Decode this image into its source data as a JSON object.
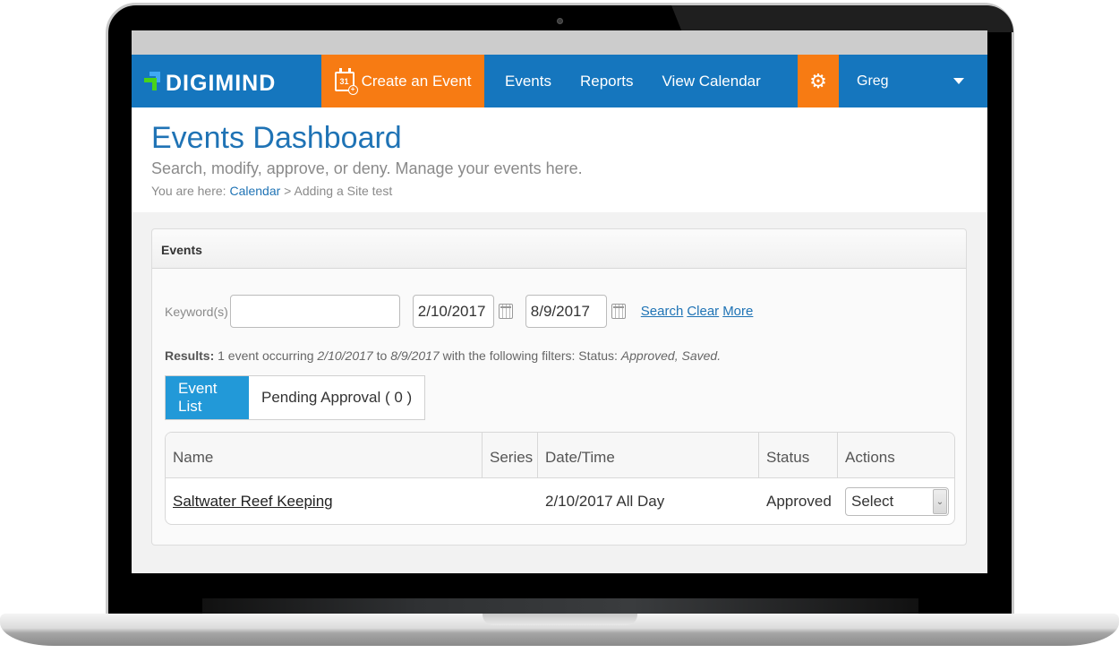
{
  "app": {
    "logo_text": "DIGIMIND"
  },
  "nav": {
    "create_label": "Create an Event",
    "create_icon_day": "31",
    "links": [
      "Events",
      "Reports",
      "View Calendar"
    ],
    "user_name": "Greg"
  },
  "header": {
    "title": "Events Dashboard",
    "subtitle": "Search, modify, approve, or deny. Manage your events here.",
    "breadcrumb_prefix": "You are here:",
    "breadcrumb_link": "Calendar",
    "breadcrumb_separator": ">",
    "breadcrumb_current": "Adding a Site test"
  },
  "panel": {
    "title": "Events",
    "keyword_label": "Keyword(s)",
    "keyword_value": "",
    "start_date": "2/10/2017",
    "end_date": "8/9/2017",
    "search_link": "Search",
    "clear_link": "Clear",
    "more_link": "More"
  },
  "results": {
    "label": "Results:",
    "text_1": "1 event occurring",
    "start": "2/10/2017",
    "text_2": "to",
    "end": "8/9/2017",
    "text_3": "with the following filters: Status:",
    "statuses": "Approved, Saved."
  },
  "tabs": [
    {
      "label": "Event List",
      "active": true
    },
    {
      "label": "Pending Approval ( 0 )",
      "active": false
    }
  ],
  "table": {
    "columns": [
      "Name",
      "Series",
      "Date/Time",
      "Status",
      "Actions"
    ],
    "rows": [
      {
        "name": "Saltwater Reef Keeping",
        "series": "",
        "datetime": "2/10/2017 All Day",
        "status": "Approved",
        "action": "Select"
      }
    ]
  },
  "colors": {
    "nav_blue": "#1576be",
    "accent_orange": "#f77b13",
    "tab_active": "#2299d8",
    "title_blue": "#1f73b5"
  }
}
